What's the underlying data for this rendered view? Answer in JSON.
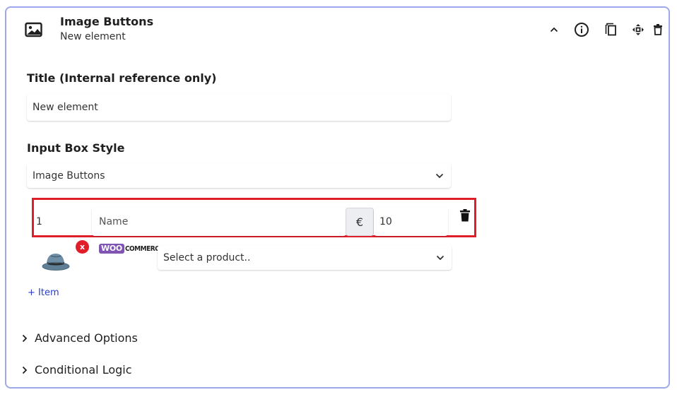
{
  "header": {
    "title": "Image Buttons",
    "subtitle": "New element",
    "icon": "image-icon",
    "tools": [
      "chevron-up-icon",
      "info-icon",
      "copy-icon",
      "move-icon",
      "trash-icon"
    ]
  },
  "title_field": {
    "label": "Title (Internal reference only)",
    "value": "New element"
  },
  "input_box_style": {
    "label": "Input Box Style",
    "selected": "Image Buttons"
  },
  "item_row": {
    "number": "1",
    "name_placeholder": "Name",
    "currency_symbol": "€",
    "price": "10",
    "remove_badge": "x"
  },
  "product": {
    "logo_badge": "WOO",
    "logo_text": "COMMERCE",
    "placeholder": "Select a product.."
  },
  "add_item_label": "+ Item",
  "sections": {
    "advanced": "Advanced Options",
    "conditional": "Conditional Logic"
  },
  "colors": {
    "border": "#9ea9ec",
    "highlight": "#e01e2a",
    "accent": "#2b3cc7",
    "woo": "#7f54b3"
  }
}
